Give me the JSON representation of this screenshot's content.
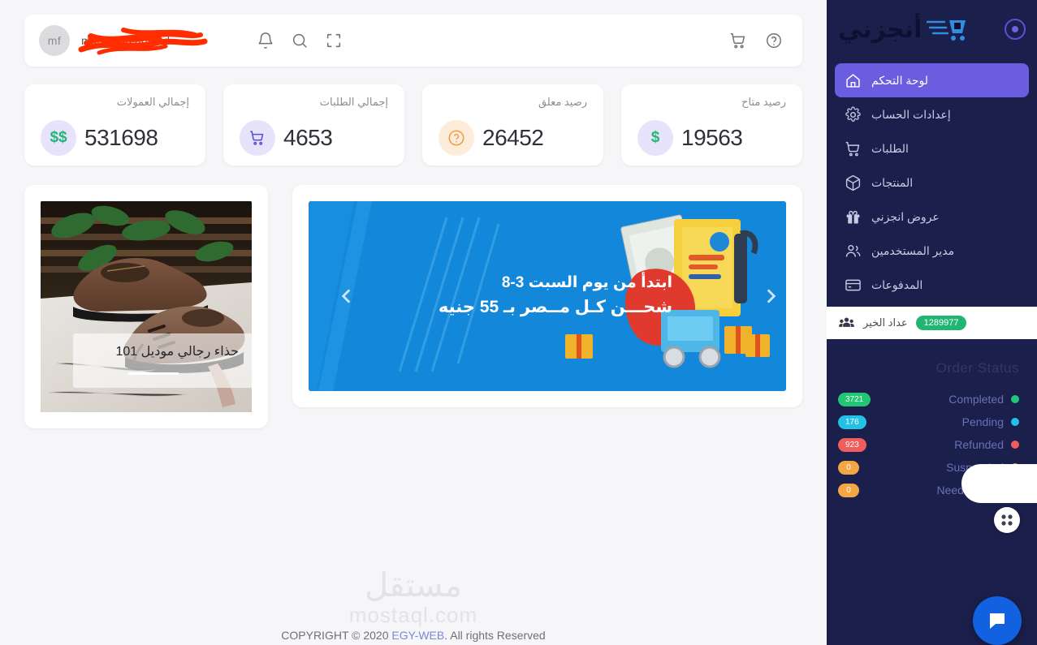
{
  "topbar": {
    "avatar_initials": "mf",
    "user_name": "mahmoud ahmed",
    "user_name_redacted": true,
    "icons": {
      "bell": "bell-icon",
      "search": "search-icon",
      "fullscreen": "fullscreen-icon",
      "cart": "cart-icon",
      "help": "help-icon"
    }
  },
  "stats": [
    {
      "label": "رصيد متاح",
      "value": "19563",
      "icon": "dollar-icon",
      "icon_glyph": "$",
      "icon_bg": "#e6e3fb",
      "icon_color": "#22b573"
    },
    {
      "label": "رصيد معلق",
      "value": "26452",
      "icon": "question-icon",
      "icon_glyph": "?",
      "icon_bg": "#fdecd9",
      "icon_color": "#f0a04b"
    },
    {
      "label": "إجمالي الطلبات",
      "value": "4653",
      "icon": "cart-icon",
      "icon_glyph": "",
      "icon_bg": "#e6e3fb",
      "icon_color": "#5b4fd6"
    },
    {
      "label": "إجمالي العمولات",
      "value": "531698",
      "icon": "double-dollar-icon",
      "icon_glyph": "$$",
      "icon_bg": "#e6e3fb",
      "icon_color": "#22b573"
    }
  ],
  "banner": {
    "line1": "ابتدأ من يوم السبت 3-8",
    "line2": "شحـــن كـل مــصر بـ 55 جنيه",
    "bg_color": "#1387da",
    "prev_label": "prev-slide",
    "next_label": "next-slide"
  },
  "product": {
    "title": "حذاء رجالي موديل 101"
  },
  "footer": {
    "watermark_ar": "مستقل",
    "watermark_en": "mostaql.com",
    "copyright_prefix": "COPYRIGHT © 2020 ",
    "copyright_link": "EGY-WEB",
    "copyright_suffix": ". All rights Reserved"
  },
  "sidebar": {
    "logo_text": "أنجزني",
    "toggle_label": "sidebar-toggle",
    "items": [
      {
        "label": "لوحة التحكم",
        "icon": "home-icon",
        "active": true
      },
      {
        "label": "إعدادات الحساب",
        "icon": "gear-icon",
        "active": false
      },
      {
        "label": "الطلبات",
        "icon": "cart-icon",
        "active": false
      },
      {
        "label": "المنتجات",
        "icon": "box-icon",
        "active": false
      },
      {
        "label": "عروض انجزني",
        "icon": "gift-icon",
        "active": false
      },
      {
        "label": "مدير المستخدمين",
        "icon": "users-icon",
        "active": false
      },
      {
        "label": "المدفوعات",
        "icon": "card-icon",
        "active": false
      }
    ],
    "counter": {
      "label": "عداد الخير",
      "value": "1289977",
      "icon": "group-icon",
      "badge_color": "#21b573"
    },
    "order_status": {
      "title": "Order Status",
      "rows": [
        {
          "label": "Completed",
          "count": "3721",
          "color": "#22c773"
        },
        {
          "label": "Pending",
          "count": "176",
          "color": "#23c0e8"
        },
        {
          "label": "Refunded",
          "count": "923",
          "color": "#ef5d5d"
        },
        {
          "label": "Suspended",
          "count": "0",
          "color": "#f4a545"
        },
        {
          "label": "Need Update",
          "count": "0",
          "color": "#f4a545"
        }
      ]
    },
    "bg_color": "#1b1f4b",
    "active_color": "#6a5de0"
  },
  "floating": {
    "grid_button": "apps-grid-button",
    "chat_button": "chat-button"
  }
}
